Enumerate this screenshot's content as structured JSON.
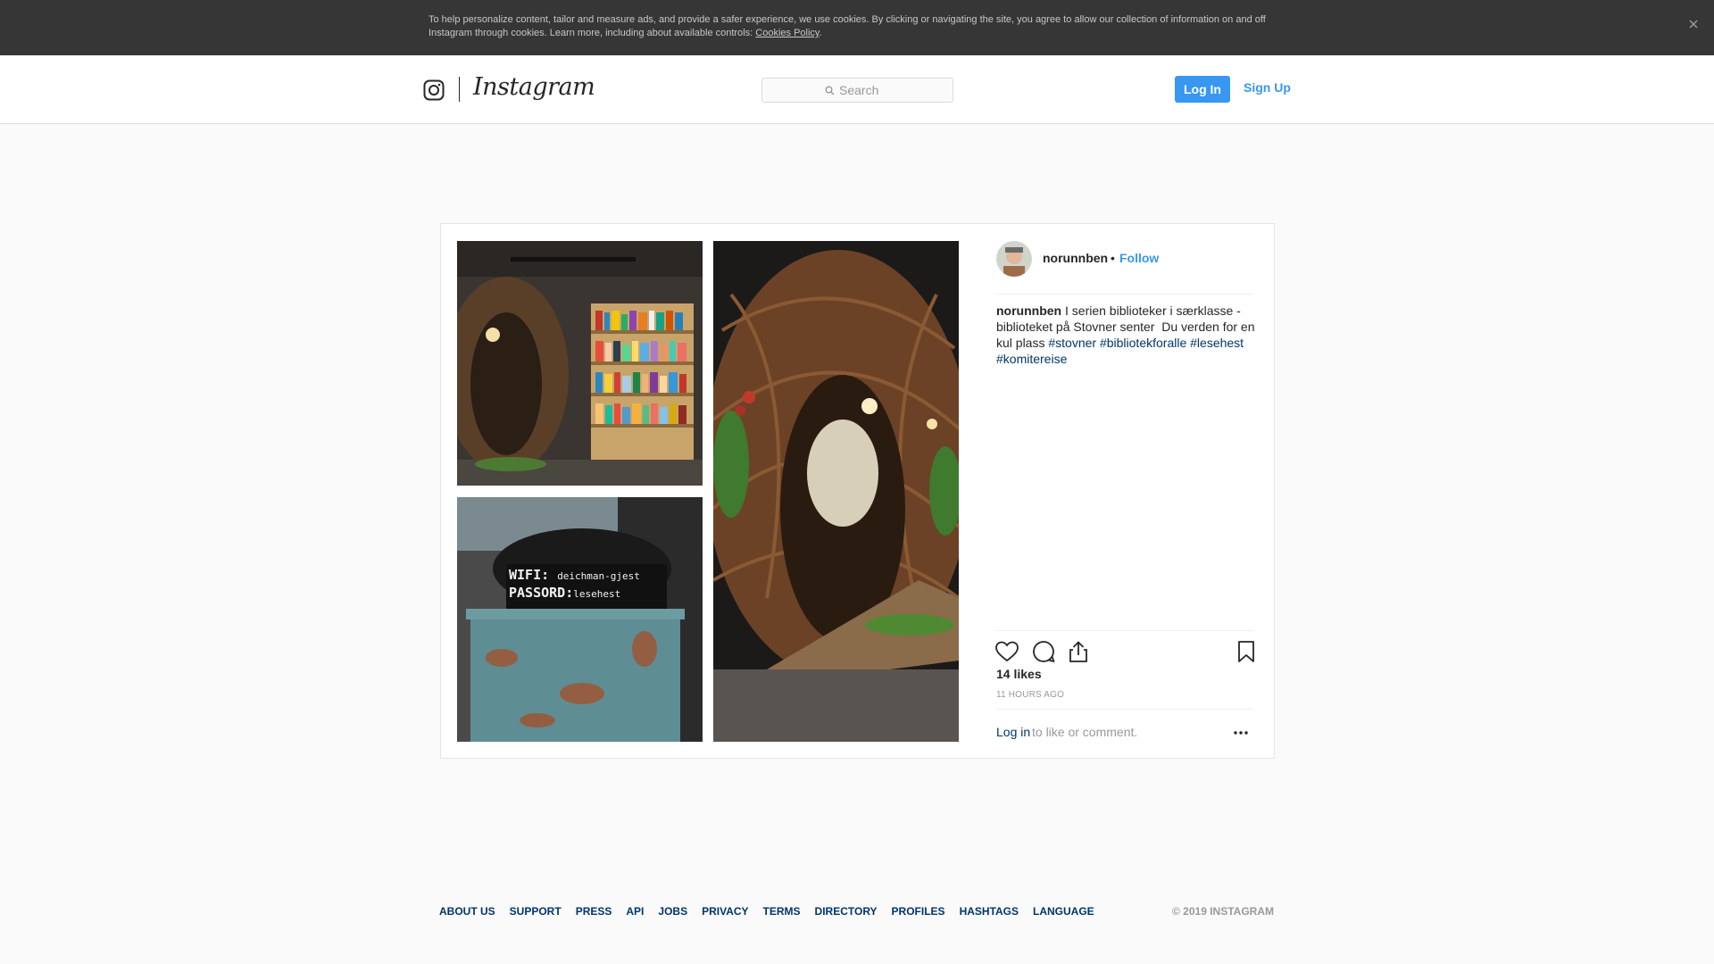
{
  "cookie_banner": {
    "text": "To help personalize content, tailor and measure ads, and provide a safer experience, we use cookies. By clicking or navigating the site, you agree to allow our collection of information on and off Instagram through cookies. Learn more, including about available controls:",
    "policy_link": "Cookies Policy",
    "period": ".",
    "close_icon": "close-icon"
  },
  "header": {
    "logo_text": "Instagram",
    "search_placeholder": "Search",
    "login_label": "Log In",
    "signup_label": "Sign Up"
  },
  "post": {
    "username": "norunnben",
    "bullet": "•",
    "follow_label": "Follow",
    "caption_user": "norunnben",
    "caption_text": " I serien biblioteker i særklasse - biblioteket på Stovner senter⁣ ⁣ Du verden for en kul plass ",
    "hashtags": [
      "#stovner",
      "#bibliotekforalle",
      "#lesehest",
      "#komitereise"
    ],
    "likes": "14 likes",
    "time": "11 HOURS AGO",
    "login_link": "Log in",
    "login_rest": " to like or comment.",
    "photos": [
      {
        "icon": "library-shelves-photo"
      },
      {
        "icon": "wicker-cave-photo"
      },
      {
        "icon": "wifi-sign-bin-photo"
      }
    ],
    "photo_sign": {
      "line1": "WIFI:",
      "line1b": "deichman-gjest",
      "line2": "PASSORD:",
      "line2b": "lesehest"
    }
  },
  "footer": {
    "links": [
      "ABOUT US",
      "SUPPORT",
      "PRESS",
      "API",
      "JOBS",
      "PRIVACY",
      "TERMS",
      "DIRECTORY",
      "PROFILES",
      "HASHTAGS",
      "LANGUAGE"
    ],
    "copyright": "© 2019 INSTAGRAM"
  },
  "colors": {
    "accent": "#3897f0",
    "link_dark": "#003569",
    "banner_bg": "#363636"
  }
}
